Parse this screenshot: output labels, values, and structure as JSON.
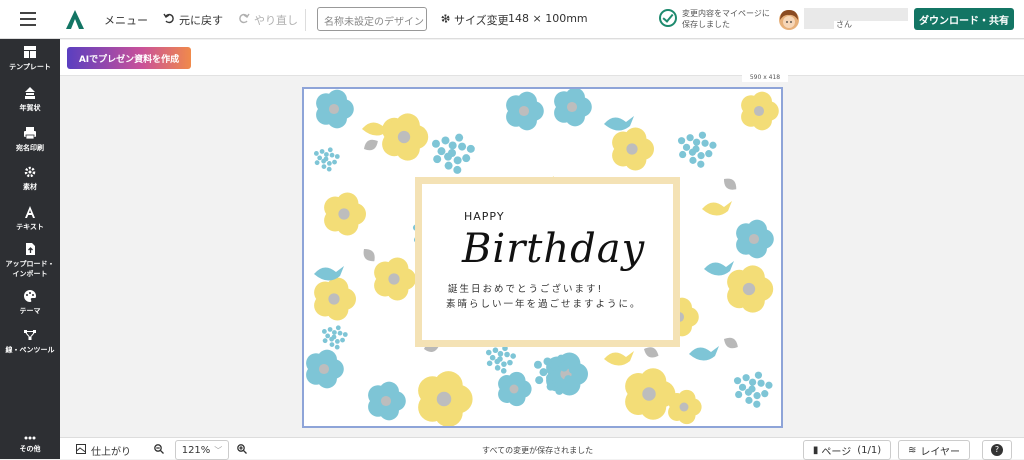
{
  "topbar": {
    "menu_label": "メニュー",
    "undo_label": "元に戻す",
    "redo_label": "やり直し",
    "design_name_placeholder": "名称未設定のデザイン",
    "size_change_label": "サイズ変更",
    "size_value": "148 × 100mm",
    "saved_text_line1": "変更内容をマイページに",
    "saved_text_line2": "保存しました",
    "user_suffix": "さん",
    "download_label": "ダウンロード・共有"
  },
  "sidebar": {
    "items": [
      {
        "label": "テンプレート",
        "icon": "template-icon"
      },
      {
        "label": "年賀状",
        "icon": "new-year-card-icon"
      },
      {
        "label": "宛名印刷",
        "icon": "printer-icon"
      },
      {
        "label": "素材",
        "icon": "material-icon"
      },
      {
        "label": "テキスト",
        "icon": "text-icon"
      },
      {
        "label": "アップロード・",
        "label2": "インポート",
        "icon": "upload-icon"
      },
      {
        "label": "テーマ",
        "icon": "palette-icon"
      },
      {
        "label": "線・ペンツール",
        "icon": "pen-tool-icon"
      },
      {
        "label": "その他",
        "icon": "more-icon"
      }
    ]
  },
  "subbar": {
    "ai_button_label": "AIでプレゼン資料を作成"
  },
  "canvas": {
    "size_label": "590 x 418",
    "card": {
      "happy": "HAPPY",
      "birthday": "Birthday",
      "message_line1": "誕生日おめでとうございます!",
      "message_line2": "素晴らしい一年を過ごせますように。"
    }
  },
  "bottombar": {
    "finish_label": "仕上がり",
    "zoom_value": "121%",
    "status_text": "すべての変更が保存されました",
    "page_label": "ページ",
    "page_count": "(1/1)",
    "layer_label": "レイヤー",
    "help_label": "?"
  },
  "colors": {
    "accent": "#137564",
    "sidebar_bg": "#2d2f33",
    "flower_blue": "#7ec5d6",
    "flower_yellow": "#f3dd77",
    "frame": "#f4e2b5",
    "card_border": "#8ea4d8"
  }
}
